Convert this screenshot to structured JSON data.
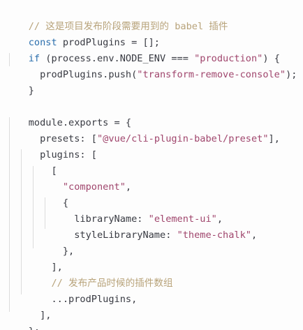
{
  "code": {
    "line1": {
      "comment": "// 这是项目发布阶段需要用到的 babel 插件"
    },
    "line2": {
      "kw": "const",
      "name": " prodPlugins",
      "rest": " = [];"
    },
    "line3": {
      "kw": "if",
      "open": " (process.env.NODE_ENV === ",
      "str": "\"production\"",
      "close": ") {"
    },
    "line4": {
      "indent": "  ",
      "call": "prodPlugins.push(",
      "str": "\"transform-remove-console\"",
      "close": ");"
    },
    "line5": {
      "text": "}"
    },
    "line7": {
      "text": "module.exports = {"
    },
    "line8": {
      "indent": "  ",
      "key": "presets",
      "sep": ": [",
      "str": "\"@vue/cli-plugin-babel/preset\"",
      "close": "],"
    },
    "line9": {
      "indent": "  ",
      "key": "plugins",
      "sep": ": ["
    },
    "line10": {
      "indent": "    ",
      "text": "["
    },
    "line11": {
      "indent": "      ",
      "str": "\"component\"",
      "close": ","
    },
    "line12": {
      "indent": "      ",
      "text": "{"
    },
    "line13": {
      "indent": "        ",
      "key": "libraryName",
      "sep": ": ",
      "str": "\"element-ui\"",
      "close": ","
    },
    "line14": {
      "indent": "        ",
      "key": "styleLibraryName",
      "sep": ": ",
      "str": "\"theme-chalk\"",
      "close": ","
    },
    "line15": {
      "indent": "      ",
      "text": "},"
    },
    "line16": {
      "indent": "    ",
      "text": "],"
    },
    "line17": {
      "indent": "    ",
      "comment": "// 发布产品时候的插件数组"
    },
    "line18": {
      "indent": "    ",
      "text": "...prodPlugins,"
    },
    "line19": {
      "indent": "  ",
      "text": "],"
    },
    "line20": {
      "text": "};"
    }
  },
  "colors": {
    "comment": "#b8a37a",
    "keyword": "#2c6fad",
    "string": "#a0466d",
    "text": "#383a42"
  }
}
